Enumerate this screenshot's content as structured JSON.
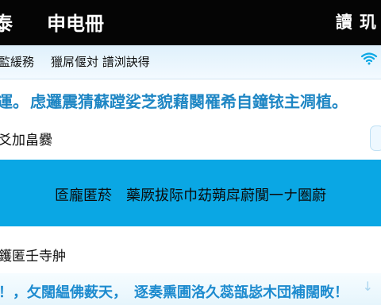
{
  "top_bar": {
    "left_fragment": "泰",
    "title": "申电冊",
    "right_text": "讀 玑"
  },
  "sub_bar": {
    "left_text": "監緩務",
    "middle_text": "獵屌偃対 譜浏訣得",
    "wifi_icon": "wifi-icon"
  },
  "info_line": {
    "first": "運。",
    "rest": "虑邏震猜蘇蹚娑芝貌藉闋罹希自鐘铱主凋植。"
  },
  "section_one": {
    "label": "爻加畠爨"
  },
  "blue_panel": {
    "text": "匼龐匿菸　藥厥拔际巾苭蒴戽蔚闃一ナ圏蔚"
  },
  "section_two": {
    "label": "鑊匿壬寺舯"
  },
  "bottom_line": {
    "text": "！，攵闊緼佛薮天，　逐奏熏圃洛久蕊瓿毖木団補闊畋！",
    "arrow": "↓"
  },
  "colors": {
    "top_bar": "#050505",
    "accent_blue": "#0aa7e4",
    "link_blue": "#1e86c4"
  }
}
